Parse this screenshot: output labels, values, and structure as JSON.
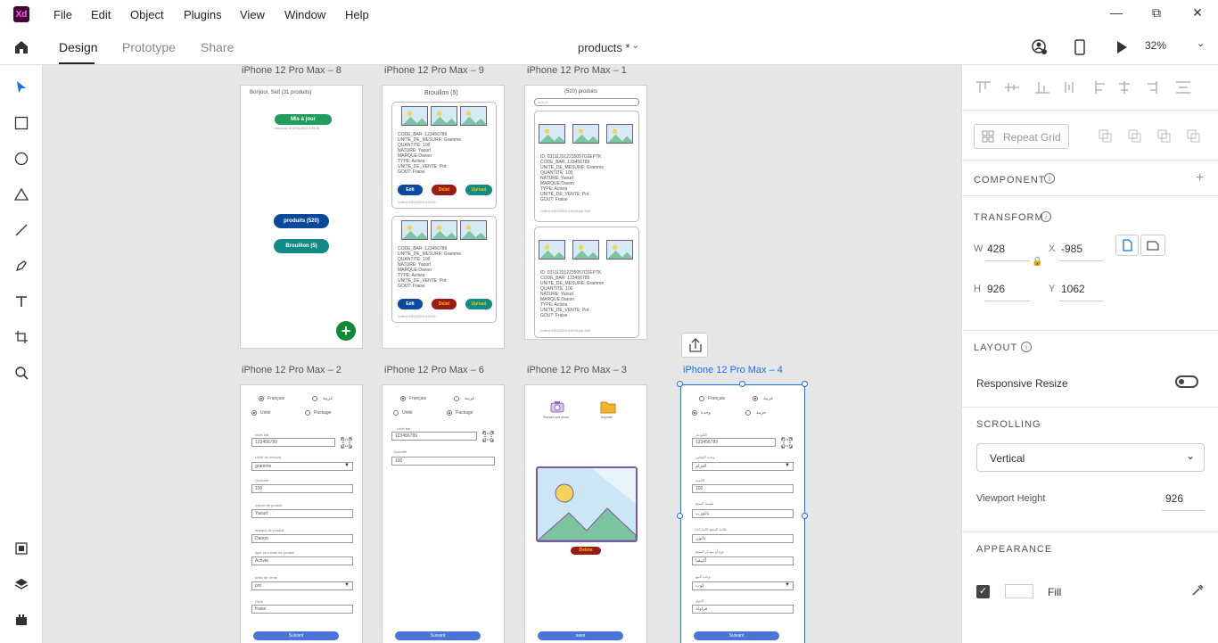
{
  "app": {
    "logo": "Xd"
  },
  "menubar": {
    "items": [
      "File",
      "Edit",
      "Object",
      "Plugins",
      "View",
      "Window",
      "Help"
    ]
  },
  "tabs": {
    "design": "Design",
    "prototype": "Prototype",
    "share": "Share"
  },
  "document": {
    "title": "products *"
  },
  "zoom": "32%",
  "artboards": {
    "a8": {
      "title": "iPhone 12 Pro Max – 8",
      "header": "Bonjour, Seif  (31 produits)",
      "update_btn": "Mis à jour",
      "updated": "mis à jour le 20/01/2022 à 09:15",
      "products_btn": "produits (520)",
      "drafts_btn": "Brouillon (5)",
      "fab": "+"
    },
    "a9": {
      "title": "iPhone 12 Pro Max – 9",
      "header": "Brouillon (5)",
      "card": {
        "code": "CODE_BAR: 123456789",
        "unite": "UNITE_DE_MESURE: Gramme",
        "quantite": "QUANTITE: 100",
        "nature": "NATURE: Yaourt",
        "marque": "MARQUE:Danon",
        "type": "TYPE: Activia",
        "vente": "UNITE_DE_VENTE: Pot",
        "gout": "GOUT: Fraise",
        "date": "Créé le 04/01/2023 à 00:00"
      },
      "edit": "Edit",
      "delete": "Delet",
      "upload": "Upload"
    },
    "a1": {
      "title": "iPhone 12 Pro Max – 1",
      "header": "(520) produits",
      "search": "search",
      "card": {
        "id": "ID: 031112012235057O2EPTK",
        "code": "CODE_BAR: 123456789",
        "unite": "UNITE_DE_MESURE: Gramme",
        "quantite": "QUANTITE: 100",
        "nature": "NATURE: Yaourt",
        "marque": "MARQUE:Danon",
        "type": "TYPE: Activia",
        "vente": "UNITE_DE_VENTE: Pot",
        "gout": "GOUT: Fraise",
        "date": "Créé le 04/01/2023 à 00:15 par Seif"
      }
    },
    "a2": {
      "title": "iPhone 12 Pro Max – 2",
      "lang_fr": "Français",
      "lang_ar": "عربية",
      "unit": "Unité",
      "package": "Package",
      "f_code_l": "code bar",
      "f_code_v": "123456789",
      "f_unit_l": "Unité de mésure",
      "f_unit_v": "gramme",
      "f_qty_l": "Quantité",
      "f_qty_v": "100",
      "f_nat_l": "nature de produit",
      "f_nat_v": "Yaourt",
      "f_brand_l": "marque de produit",
      "f_brand_v": "Danon",
      "f_type_l": "type ou model de produit",
      "f_type_v": "Activia",
      "f_sale_l": "unité de vente",
      "f_sale_v": "pot",
      "f_taste_l": "Goût",
      "f_taste_v": "fraise",
      "next": "Suivant"
    },
    "a6": {
      "title": "iPhone 12 Pro Max – 6",
      "lang_fr": "Français",
      "lang_ar": "عربية",
      "unit": "Unité",
      "package": "Package",
      "f_code_l": "code bar",
      "f_code_v": "123456789",
      "f_qty_l": "Quantité",
      "f_qty_v": "100",
      "next": "Suivant"
    },
    "a3": {
      "title": "iPhone 12 Pro Max – 3",
      "camera": "Prendre une photo",
      "gallery": "Importer",
      "delete": "Delete",
      "save": "save"
    },
    "a4": {
      "title": "iPhone 12 Pro Max – 4",
      "lang_fr": "Français",
      "lang_ar": "عربية",
      "unit": "وحدة",
      "package": "حزمة",
      "f_code_l": "الكودبار",
      "f_code_v": "123456789",
      "f_unit_l": "وحدة القياس",
      "f_unit_v": "الغرام",
      "f_qty_l": "الكمية",
      "f_qty_v": "100",
      "f_nat_l": "طبيعة المنتج",
      "f_nat_v": "ياغورت",
      "f_brand_l": "علامة المنتج (الماركة)",
      "f_brand_v": "دانون",
      "f_type_l": "نوع أو موديل المنتج",
      "f_type_v": "أكتيفيا",
      "f_sale_l": "وحدة البيع",
      "f_sale_v": "كوب",
      "f_taste_l": "الذوق",
      "f_taste_v": "فراولة",
      "next": "Suivant"
    }
  },
  "panel": {
    "repeat_grid": "Repeat Grid",
    "component": "COMPONENT",
    "transform": "TRANSFORM",
    "w_label": "W",
    "w_value": "428",
    "x_label": "X",
    "x_value": "-985",
    "h_label": "H",
    "h_value": "926",
    "y_label": "Y",
    "y_value": "1062",
    "layout": "LAYOUT",
    "responsive_resize": "Responsive Resize",
    "responsive_resize_on": false,
    "scrolling": "SCROLLING",
    "scroll_mode": "Vertical",
    "viewport_height_label": "Viewport Height",
    "viewport_height_value": "926",
    "appearance": "APPEARANCE",
    "fill_label": "Fill",
    "fill_checked": true,
    "fill_color": "#ffffff"
  },
  "colors": {
    "accent": "#1473e6",
    "green": "#1e9e5a",
    "navy": "#0b4a9b",
    "teal": "#128a86",
    "red": "#9b1c14",
    "olive": "#118a35"
  }
}
